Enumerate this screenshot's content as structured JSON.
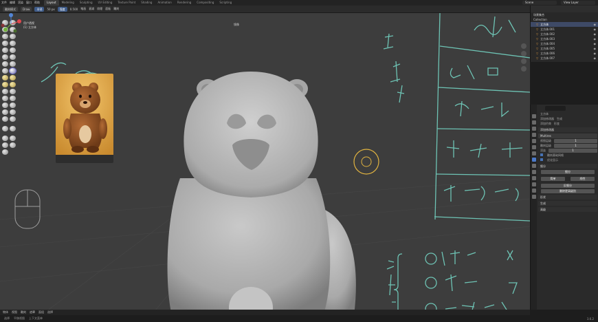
{
  "topbar": {
    "menu": [
      "文件",
      "编辑",
      "渲染",
      "窗口",
      "帮助"
    ],
    "tabs": [
      "Layout",
      "Modeling",
      "Sculpting",
      "UV Editing",
      "Texture Paint",
      "Shading",
      "Animation",
      "Rendering",
      "Compositing",
      "Scripting"
    ],
    "active_tab": "Layout",
    "scene": "Scene",
    "view_layer": "View Layer"
  },
  "tool_header": {
    "mode": "雕刻模式",
    "brush": "Draw",
    "radius_label": "半径",
    "radius_value": "50 px",
    "strength_label": "强度",
    "strength_value": "0.500",
    "items": [
      "笔画",
      "衰减",
      "纹理",
      "面板",
      "雕刻"
    ]
  },
  "viewport": {
    "overlay_lines": [
      "用户透视",
      "(1) 立方体"
    ],
    "mirror_label": "镜像",
    "accent_color": "#6ec4b5"
  },
  "outliner": {
    "title": "场景集合",
    "collection": "Collection",
    "items": [
      "立方体",
      "立方体.001",
      "立方体.002",
      "立方体.003",
      "立方体.004",
      "立方体.005",
      "立方体.006",
      "立方体.007"
    ]
  },
  "properties": {
    "object_name": "立方体",
    "add_rows": [
      [
        "添加修改器",
        "生成"
      ],
      [
        "添加约束",
        "形变"
      ]
    ],
    "section_title": "添加修改器",
    "modifier": "Multires",
    "fields": [
      {
        "label": "视图层级",
        "value": "1"
      },
      {
        "label": "雕刻层级",
        "value": "1"
      },
      {
        "label": "渲染",
        "value": "1"
      }
    ],
    "checks": [
      "雕刻基础网格",
      "优化显示"
    ],
    "subsection": "细分",
    "buttons": [
      "细分",
      "简单",
      "线性",
      "反细分",
      "删除更高级别"
    ],
    "panels": [
      "形状",
      "生成",
      "高级"
    ]
  },
  "statusbar": {
    "items": [
      "选择",
      "平移视图",
      "上下文菜单"
    ]
  },
  "bottombar": {
    "items": [
      "物体",
      "视图",
      "雕刻",
      "遮罩",
      "面组",
      "选择"
    ],
    "version": "3.6.2"
  }
}
